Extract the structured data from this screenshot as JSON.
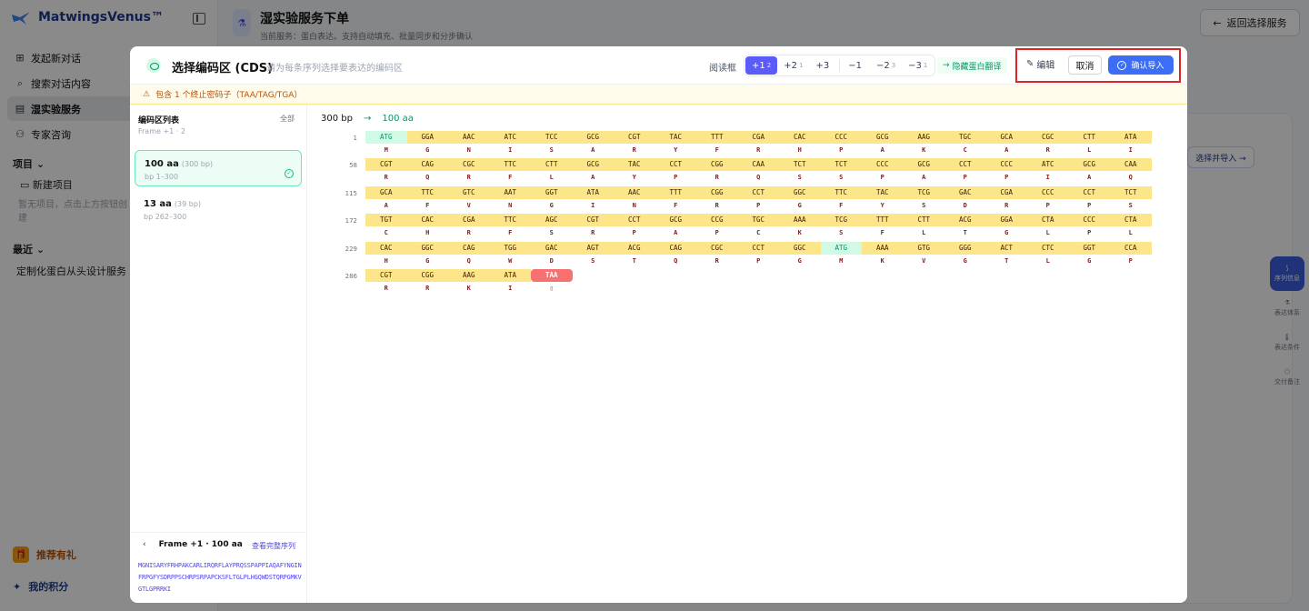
{
  "app": {
    "name": "MatwingsVenus™"
  },
  "sidebar": {
    "nav": [
      {
        "label": "发起新对话",
        "icon": "new-chat-icon"
      },
      {
        "label": "搜索对话内容",
        "icon": "search-icon"
      },
      {
        "label": "湿实验服务",
        "icon": "doc-icon",
        "active": true
      },
      {
        "label": "专家咨询",
        "icon": "expert-icon"
      }
    ],
    "projects_label": "项目",
    "new_project": "新建项目",
    "empty_text": "暂无项目，点击上方按钮创建",
    "recent_label": "最近",
    "recent_item": "定制化蛋白从头设计服务需",
    "recommend": "推荐有礼",
    "points": "我的积分"
  },
  "page": {
    "title": "湿实验服务下单",
    "subtitle": "当前服务：蛋白表达。支持自动填充、批量同步和分步确认",
    "back_button": "返回选择服务",
    "bg_select_button": "选择并导入 →",
    "rail": [
      "序列信息",
      "表达体系",
      "表达条件",
      "交付备注"
    ]
  },
  "modal": {
    "title": "选择编码区 (CDS)",
    "subtitle": "请为每条序列选择要表达的编码区",
    "reading_frame_label": "阅读框",
    "frames": [
      {
        "label": "+1",
        "count": "2",
        "active": true
      },
      {
        "label": "+2",
        "count": "1"
      },
      {
        "label": "+3",
        "count": ""
      },
      {
        "label": "−1",
        "count": ""
      },
      {
        "label": "−2",
        "count": "3"
      },
      {
        "label": "−3",
        "count": "1"
      }
    ],
    "hide_translation": "隐藏蛋白翻译",
    "edit": "编辑",
    "cancel": "取消",
    "confirm": "确认导入",
    "warning": "包含 1 个终止密码子（TAA/TAG/TGA）",
    "cds_list": {
      "title": "编码区列表",
      "frame_info": "Frame +1 · 2",
      "all_label": "全部",
      "items": [
        {
          "aa": "100 aa",
          "bp": "(300 bp)",
          "range": "bp 1–300",
          "selected": true
        },
        {
          "aa": "13 aa",
          "bp": "(39 bp)",
          "range": "bp 262–300",
          "selected": false
        }
      ]
    },
    "footer": {
      "frame_label": "Frame +1 · 100 aa",
      "view_full": "查看完整序列",
      "protein_seq": "MGNISARYFRHPAKCARLIRQRFLAYPRQSSPAPPIAQAFYNGINFRPGFYSDRPPSCHRPSRPAPCKSFLTGLPLHGQWDSTQRPGMKVGTLGPRRKI"
    },
    "sequence": {
      "length": "300 bp",
      "protein": "100 aa",
      "rows": [
        {
          "start": "1",
          "codons": [
            "ATG",
            "GGA",
            "AAC",
            "ATC",
            "TCC",
            "GCG",
            "CGT",
            "TAC",
            "TTT",
            "CGA",
            "CAC",
            "CCC",
            "GCG",
            "AAG",
            "TGC",
            "GCA",
            "CGC",
            "CTT",
            "ATA"
          ],
          "aa": [
            "M",
            "G",
            "N",
            "I",
            "S",
            "A",
            "R",
            "Y",
            "F",
            "R",
            "H",
            "P",
            "A",
            "K",
            "C",
            "A",
            "R",
            "L",
            "I"
          ]
        },
        {
          "start": "58",
          "codons": [
            "CGT",
            "CAG",
            "CGC",
            "TTC",
            "CTT",
            "GCG",
            "TAC",
            "CCT",
            "CGG",
            "CAA",
            "TCT",
            "TCT",
            "CCC",
            "GCG",
            "CCT",
            "CCC",
            "ATC",
            "GCG",
            "CAA"
          ],
          "aa": [
            "R",
            "Q",
            "R",
            "F",
            "L",
            "A",
            "Y",
            "P",
            "R",
            "Q",
            "S",
            "S",
            "P",
            "A",
            "P",
            "P",
            "I",
            "A",
            "Q"
          ]
        },
        {
          "start": "115",
          "codons": [
            "GCA",
            "TTC",
            "GTC",
            "AAT",
            "GGT",
            "ATA",
            "AAC",
            "TTT",
            "CGG",
            "CCT",
            "GGC",
            "TTC",
            "TAC",
            "TCG",
            "GAC",
            "CGA",
            "CCC",
            "CCT",
            "TCT"
          ],
          "aa": [
            "A",
            "F",
            "V",
            "N",
            "G",
            "I",
            "N",
            "F",
            "R",
            "P",
            "G",
            "F",
            "Y",
            "S",
            "D",
            "R",
            "P",
            "P",
            "S"
          ]
        },
        {
          "start": "172",
          "codons": [
            "TGT",
            "CAC",
            "CGA",
            "TTC",
            "AGC",
            "CGT",
            "CCT",
            "GCG",
            "CCG",
            "TGC",
            "AAA",
            "TCG",
            "TTT",
            "CTT",
            "ACG",
            "GGA",
            "CTA",
            "CCC",
            "CTA"
          ],
          "aa": [
            "C",
            "H",
            "R",
            "F",
            "S",
            "R",
            "P",
            "A",
            "P",
            "C",
            "K",
            "S",
            "F",
            "L",
            "T",
            "G",
            "L",
            "P",
            "L"
          ]
        },
        {
          "start": "229",
          "codons": [
            "CAC",
            "GGC",
            "CAG",
            "TGG",
            "GAC",
            "AGT",
            "ACG",
            "CAG",
            "CGC",
            "CCT",
            "GGC",
            "ATG",
            "AAA",
            "GTG",
            "GGG",
            "ACT",
            "CTC",
            "GGT",
            "CCA"
          ],
          "aa": [
            "H",
            "G",
            "Q",
            "W",
            "D",
            "S",
            "T",
            "Q",
            "R",
            "P",
            "G",
            "M",
            "K",
            "V",
            "G",
            "T",
            "L",
            "G",
            "P"
          ]
        },
        {
          "start": "286",
          "codons": [
            "CGT",
            "CGG",
            "AAG",
            "ATA",
            "TAA"
          ],
          "aa": [
            "R",
            "R",
            "K",
            "I",
            "*"
          ]
        }
      ]
    }
  }
}
